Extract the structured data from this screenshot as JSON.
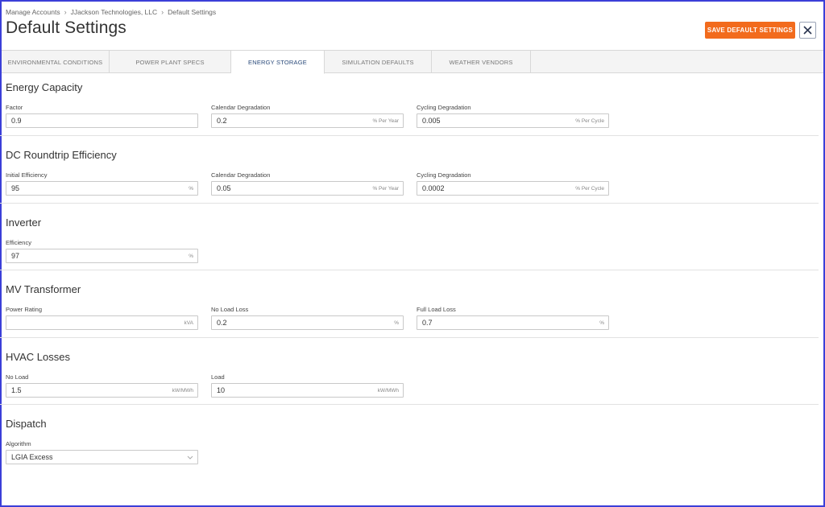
{
  "breadcrumb": [
    "Manage Accounts",
    "JJackson Technologies, LLC",
    "Default Settings"
  ],
  "page_title": "Default Settings",
  "save_label": "SAVE DEFAULT SETTINGS",
  "tabs": [
    "ENVIRONMENTAL CONDITIONS",
    "POWER PLANT SPECS",
    "ENERGY STORAGE",
    "SIMULATION DEFAULTS",
    "WEATHER VENDORS"
  ],
  "active_tab": "ENERGY STORAGE",
  "colors": {
    "accent": "#f26b1d",
    "active_tab_text": "#2a4a7a",
    "frame": "#3b3fd8"
  },
  "sections": {
    "energy_capacity": {
      "title": "Energy Capacity",
      "factor": {
        "label": "Factor",
        "value": "0.9",
        "unit": ""
      },
      "calendar_degradation": {
        "label": "Calendar Degradation",
        "value": "0.2",
        "unit": "% Per Year"
      },
      "cycling_degradation": {
        "label": "Cycling Degradation",
        "value": "0.005",
        "unit": "% Per Cycle"
      }
    },
    "dc_roundtrip": {
      "title": "DC Roundtrip Efficiency",
      "initial_efficiency": {
        "label": "Initial Efficiency",
        "value": "95",
        "unit": "%"
      },
      "calendar_degradation": {
        "label": "Calendar Degradation",
        "value": "0.05",
        "unit": "% Per Year"
      },
      "cycling_degradation": {
        "label": "Cycling Degradation",
        "value": "0.0002",
        "unit": "% Per Cycle"
      }
    },
    "inverter": {
      "title": "Inverter",
      "efficiency": {
        "label": "Efficiency",
        "value": "97",
        "unit": "%"
      }
    },
    "mv_transformer": {
      "title": "MV Transformer",
      "power_rating": {
        "label": "Power Rating",
        "value": "",
        "unit": "kVA"
      },
      "no_load_loss": {
        "label": "No Load Loss",
        "value": "0.2",
        "unit": "%"
      },
      "full_load_loss": {
        "label": "Full Load Loss",
        "value": "0.7",
        "unit": "%"
      }
    },
    "hvac_losses": {
      "title": "HVAC Losses",
      "no_load": {
        "label": "No Load",
        "value": "1.5",
        "unit": "kW/MWh"
      },
      "load": {
        "label": "Load",
        "value": "10",
        "unit": "kW/MWh"
      }
    },
    "dispatch": {
      "title": "Dispatch",
      "algorithm": {
        "label": "Algorithm",
        "value": "LGIA Excess"
      }
    }
  }
}
